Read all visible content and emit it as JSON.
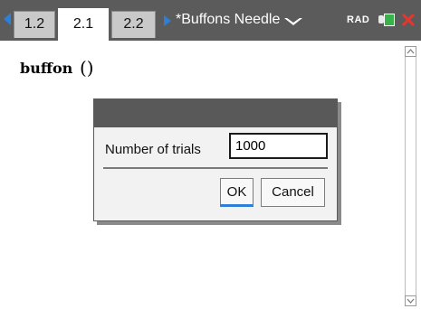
{
  "tabs": [
    {
      "label": "1.2",
      "active": false
    },
    {
      "label": "2.1",
      "active": true
    },
    {
      "label": "2.2",
      "active": false
    }
  ],
  "document_title": "*Buffons Needle",
  "angle_mode": "RAD",
  "colors": {
    "tabbar": "#5b5b5b",
    "nav_arrow": "#2e7fd8",
    "battery": "#37b34a",
    "close": "#e8352e",
    "dialog_title": "#595959"
  },
  "icons": {
    "prev": "triangle-left",
    "next": "triangle-right",
    "document_menu": "chevron-down",
    "battery": "battery",
    "close": "x"
  },
  "workspace": {
    "expression": "buffon",
    "paren": "()"
  },
  "dialog": {
    "field_label": "Number of trials",
    "field_value": "1000",
    "ok_label": "OK",
    "cancel_label": "Cancel"
  }
}
